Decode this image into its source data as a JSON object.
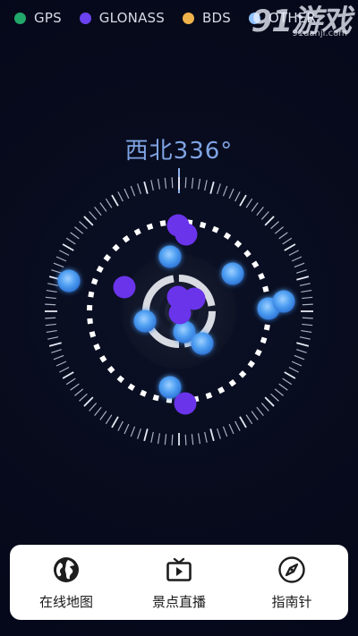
{
  "legend": [
    {
      "label": "GPS",
      "color": "#22a86a"
    },
    {
      "label": "GLONASS",
      "color": "#6a42f0"
    },
    {
      "label": "BDS",
      "color": "#f0b24a"
    },
    {
      "label": "OTHER",
      "color": "#8fc0ff"
    }
  ],
  "watermark": {
    "big": "91游戏",
    "small": "91danji.com"
  },
  "compass": {
    "heading": "西北336°",
    "direction": "西北",
    "degrees": 336
  },
  "satellite_colors": {
    "glonass": "#6a34ea",
    "other": "#4f9ff2"
  },
  "nav": [
    {
      "label": "在线地图",
      "icon": "globe-icon"
    },
    {
      "label": "景点直播",
      "icon": "tv-icon"
    },
    {
      "label": "指南针",
      "icon": "compass-icon"
    }
  ]
}
